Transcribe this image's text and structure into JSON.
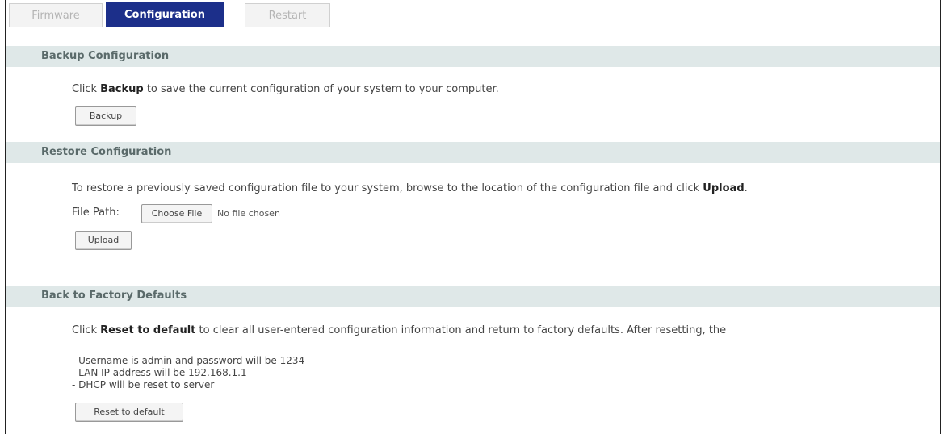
{
  "tabs": [
    {
      "label": "Firmware",
      "active": false
    },
    {
      "label": "Configuration",
      "active": true
    },
    {
      "label": "Restart",
      "active": false
    }
  ],
  "backup": {
    "header": "Backup Configuration",
    "text_pre": "Click ",
    "text_bold": "Backup",
    "text_post": " to save the current configuration of your system to your computer.",
    "button": "Backup"
  },
  "restore": {
    "header": "Restore Configuration",
    "text_pre": "To restore a previously saved configuration file to your system, browse to the location of the configuration file and click ",
    "text_bold": "Upload",
    "text_post": ".",
    "file_path_label": "File Path:",
    "choose_file_button": "Choose File",
    "no_file_text": "No file chosen",
    "upload_button": "Upload"
  },
  "factory": {
    "header": "Back to Factory Defaults",
    "text_pre": "Click ",
    "text_bold": "Reset to default",
    "text_post": " to clear all user-entered configuration information and return to factory defaults. After resetting, the",
    "items": [
      "- Username is admin and password will be 1234",
      "- LAN IP address will be 192.168.1.1",
      "- DHCP will be reset to server"
    ],
    "reset_button": "Reset to default"
  },
  "colors": {
    "active_tab": "#1c2f8a",
    "section_header_bg": "#dfe8e8"
  }
}
